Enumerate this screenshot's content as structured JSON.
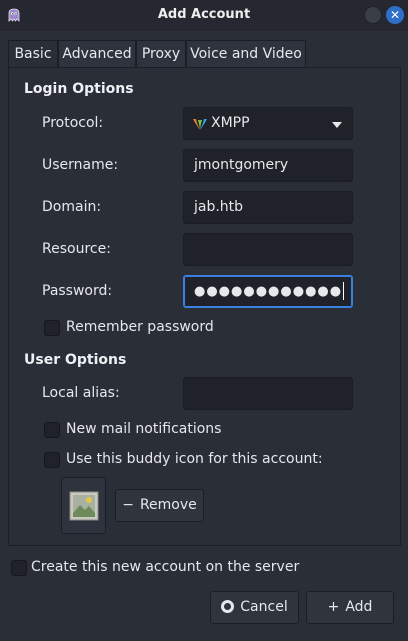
{
  "window": {
    "title": "Add Account"
  },
  "tabs": [
    {
      "label": "Basic"
    },
    {
      "label": "Advanced"
    },
    {
      "label": "Proxy"
    },
    {
      "label": "Voice and Video"
    }
  ],
  "login_options": {
    "heading": "Login Options",
    "protocol_label": "Protocol:",
    "protocol_value": "XMPP",
    "username_label": "Username:",
    "username_value": "jmontgomery",
    "domain_label": "Domain:",
    "domain_value": "jab.htb",
    "resource_label": "Resource:",
    "resource_value": "",
    "password_label": "Password:",
    "password_masked": "●●●●●●●●●●●●",
    "remember_password_label": "Remember password",
    "remember_password_checked": false
  },
  "user_options": {
    "heading": "User Options",
    "local_alias_label": "Local alias:",
    "local_alias_value": "",
    "new_mail_label": "New mail notifications",
    "new_mail_checked": false,
    "buddy_icon_label": "Use this buddy icon for this account:",
    "buddy_icon_checked": false,
    "remove_label": "Remove"
  },
  "footer": {
    "create_account_label": "Create this new account on the server",
    "create_account_checked": false,
    "cancel_label": "Cancel",
    "add_label": "Add"
  },
  "icons": {
    "app": "pidgin-icon",
    "protocol": "xmpp-icon",
    "buddy": "image-placeholder-icon"
  },
  "colors": {
    "background": "#2a2e37",
    "titlebar": "#252830",
    "entry": "#1f2229",
    "focus_accent": "#3b7fe0",
    "close_button": "#2f6ec9"
  }
}
